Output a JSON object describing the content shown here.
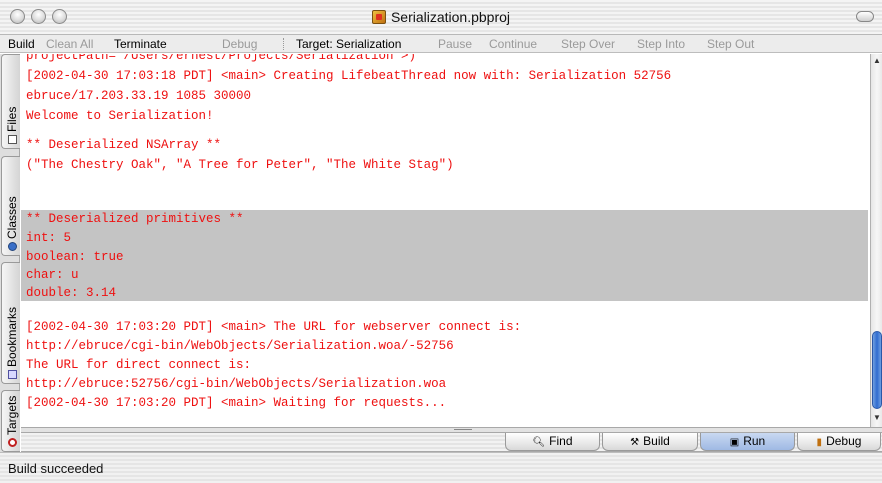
{
  "window": {
    "title": "Serialization.pbproj",
    "project_icon": "xcode-project-icon"
  },
  "toolbar": {
    "build": "Build",
    "clean_all": "Clean All",
    "terminate": "Terminate",
    "debug": "Debug",
    "target": "Target: Serialization",
    "pause": "Pause",
    "continue": "Continue",
    "step_over": "Step Over",
    "step_into": "Step Into",
    "step_out": "Step Out"
  },
  "side_tabs": [
    "Files",
    "Classes",
    "Bookmarks",
    "Targets"
  ],
  "log": {
    "lines": [
      "projectPath= /Users/ernest/Projects/Serialization >)",
      "[2002-04-30 17:03:18 PDT] <main> Creating LifebeatThread now with: Serialization 52756",
      "ebruce/17.203.33.19 1085 30000",
      "Welcome to Serialization!",
      "",
      "** Deserialized NSArray **",
      "(\"The Chestry Oak\", \"A Tree for Peter\", \"The White Stag\")",
      "",
      "** Deserialized primitives **",
      "int: 5",
      "boolean: true",
      "char: u",
      "double: 3.14",
      "",
      "[2002-04-30 17:03:20 PDT] <main> The URL for webserver connect is:",
      "http://ebruce/cgi-bin/WebObjects/Serialization.woa/-52756",
      "The URL for direct connect is:",
      "http://ebruce:52756/cgi-bin/WebObjects/Serialization.woa",
      "[2002-04-30 17:03:20 PDT] <main> Waiting for requests..."
    ],
    "text_color": "#ee1010",
    "highlight_color": "#c4c4c4"
  },
  "bottom_tabs": {
    "find": "Find",
    "build": "Build",
    "run": "Run",
    "debug": "Debug",
    "active": "Run"
  },
  "status": {
    "text": "Build succeeded"
  }
}
